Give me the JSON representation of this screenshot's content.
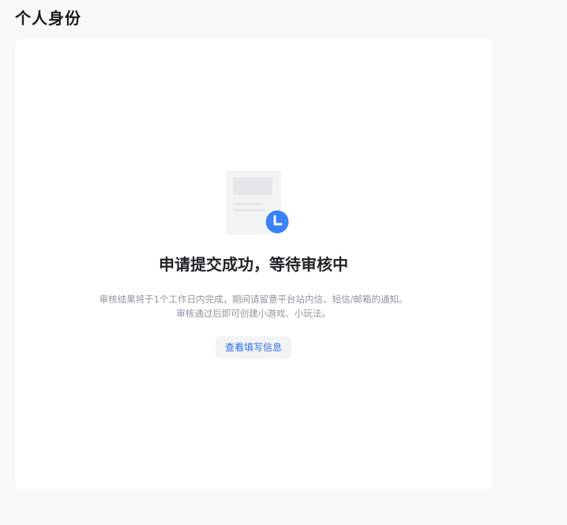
{
  "header": {
    "title": "个人身份"
  },
  "status": {
    "title": "申请提交成功，等待审核中",
    "description": "审核结果将于1个工作日内完成，期间请留意平台站内信、短信/邮箱的通知。审核通过后即可创建小游戏、小玩法。",
    "icon": "document-clock-icon",
    "accent_color": "#3b82f6"
  },
  "actions": {
    "view_info_label": "查看填写信息"
  }
}
